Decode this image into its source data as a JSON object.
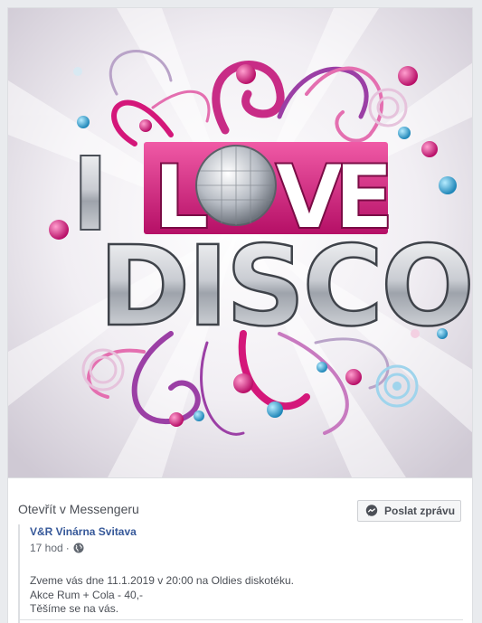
{
  "post_image": {
    "text_line1": "I LOVE",
    "text_line2": "DISCO",
    "accent_color": "#d4177a",
    "secondary_color": "#9b3fa5",
    "bubble_color": "#2c9fd0"
  },
  "messenger": {
    "open_label": "Otevřít v Messengeru",
    "send_button_label": "Poslat zprávu"
  },
  "shared_post": {
    "page_name": "V&R Vinárna Svitava",
    "timestamp": "17 hod",
    "separator": "·",
    "audience_icon": "globe-icon",
    "text_lines": [
      "Zveme vás dne 11.1.2019 v 20:00 na Oldies diskotéku.",
      "Akce Rum + Cola - 40,-",
      "Těšíme se na vás."
    ]
  }
}
